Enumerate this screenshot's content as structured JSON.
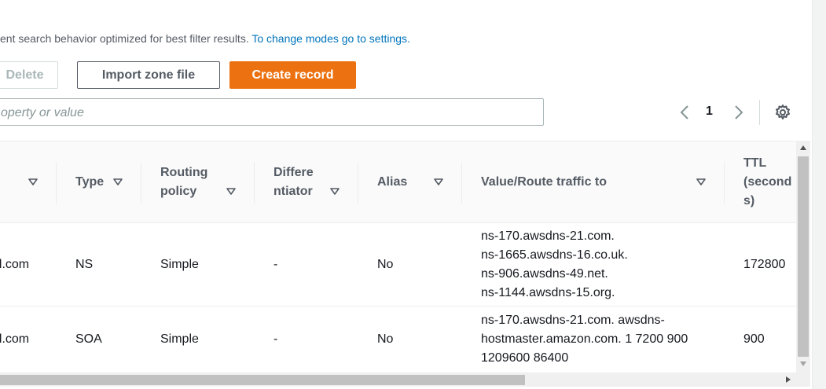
{
  "info": {
    "text": "ent search behavior optimized for best filter results.",
    "link": "To change modes go to settings."
  },
  "toolbar": {
    "delete_label": "Delete",
    "import_label": "Import zone file",
    "create_label": "Create record"
  },
  "search": {
    "placeholder": "operty or value",
    "value": ""
  },
  "pagination": {
    "current_page": "1"
  },
  "colors": {
    "primary": "#ec7211",
    "link": "#0073bb",
    "disabled": "#aab7b8"
  },
  "table": {
    "columns": [
      {
        "label": ""
      },
      {
        "label": "Type"
      },
      {
        "label": "Routing\npolicy"
      },
      {
        "label": "Differe\nntiator"
      },
      {
        "label": "Alias"
      },
      {
        "label": "Value/Route traffic to"
      },
      {
        "label": "TTL\n(second\ns)"
      }
    ],
    "rows": [
      {
        "name": "al.com",
        "type": "NS",
        "routing": "Simple",
        "differentiator": "-",
        "alias": "No",
        "value": [
          "ns-170.awsdns-21.com.",
          "ns-1665.awsdns-16.co.uk.",
          "ns-906.awsdns-49.net.",
          "ns-1144.awsdns-15.org."
        ],
        "ttl": "172800"
      },
      {
        "name": "al.com",
        "type": "SOA",
        "routing": "Simple",
        "differentiator": "-",
        "alias": "No",
        "value": [
          "ns-170.awsdns-21.com. awsdns-",
          "hostmaster.amazon.com. 1 7200 900",
          "1209600 86400"
        ],
        "ttl": "900"
      }
    ]
  }
}
